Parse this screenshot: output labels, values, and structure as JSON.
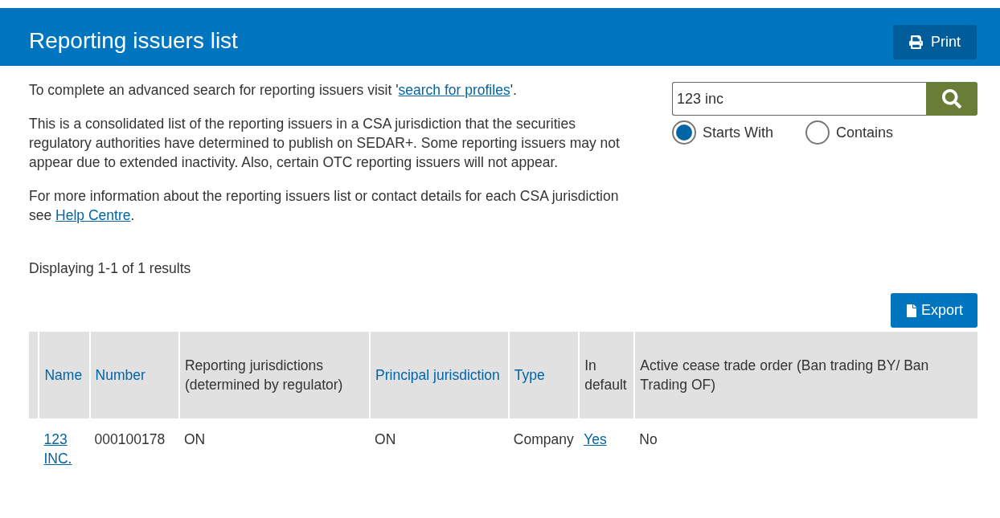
{
  "header": {
    "title": "Reporting issuers list",
    "print_button": "Print"
  },
  "intro": [
    {
      "text": "To complete an advanced search for reporting issuers visit '",
      "link": "search for profiles",
      "after": "'."
    },
    {
      "text": "This is a consolidated list of the reporting issuers in a CSA jurisdiction that the securities regulatory authorities have determined to publish on SEDAR+. Some reporting issuers may not appear due to extended inactivity. Also, certain OTC reporting issuers will not appear."
    },
    {
      "text": "For more information about the reporting issuers list or contact details for each CSA jurisdiction see ",
      "link": "Help Centre",
      "after": "."
    }
  ],
  "search": {
    "value": "123 inc",
    "options": [
      {
        "label": "Starts With",
        "selected": true
      },
      {
        "label": "Contains",
        "selected": false
      }
    ]
  },
  "results_text": "Displaying 1-1 of 1 results",
  "export_button": "Export",
  "table": {
    "columns": [
      {
        "label": "Name",
        "sortable": true
      },
      {
        "label": "Number",
        "sortable": true
      },
      {
        "label": "Reporting jurisdictions (determined by regulator)",
        "sortable": false
      },
      {
        "label": "Principal jurisdiction",
        "sortable": true
      },
      {
        "label": "Type",
        "sortable": true
      },
      {
        "label": "In default",
        "sortable": false
      },
      {
        "label": "Active cease trade order (Ban trading BY/ Ban Trading OF)",
        "sortable": false
      }
    ],
    "rows": [
      {
        "cells": [
          {
            "text": "123 INC.",
            "kind": "link"
          },
          {
            "text": "000100178",
            "kind": "text"
          },
          {
            "text": "ON",
            "kind": "text"
          },
          {
            "text": "ON",
            "kind": "text"
          },
          {
            "text": "Company",
            "kind": "text"
          },
          {
            "text": "Yes",
            "kind": "link"
          },
          {
            "text": "No",
            "kind": "text"
          }
        ]
      }
    ]
  }
}
